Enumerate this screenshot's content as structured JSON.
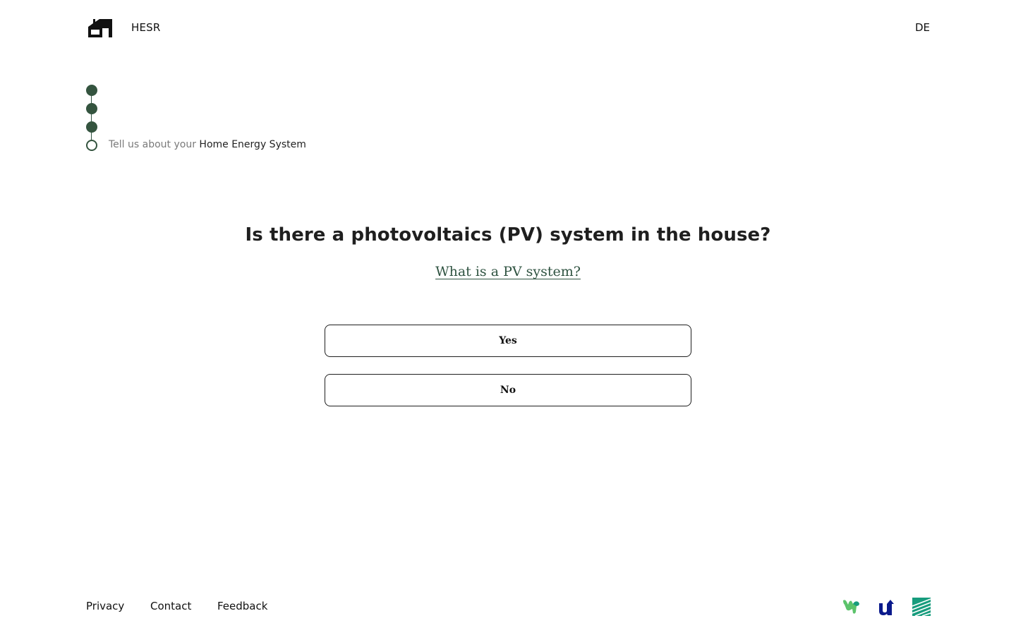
{
  "header": {
    "brand": "HESR",
    "language": "DE",
    "logo_icon": "house-icon"
  },
  "stepper": {
    "completed_steps": 3,
    "current_step_prefix": "Tell us about your",
    "current_step_title": "Home Energy System"
  },
  "main": {
    "question": "Is there a photovoltaics (PV) system in the house?",
    "help_link": "What is a PV system?",
    "options": [
      {
        "label": "Yes"
      },
      {
        "label": "No"
      }
    ]
  },
  "footer": {
    "links": [
      "Privacy",
      "Contact",
      "Feedback"
    ],
    "partner_logos": [
      "partner-logo-green-icon",
      "partner-logo-blue-icon",
      "partner-logo-teal-icon"
    ]
  },
  "colors": {
    "accent": "#34543f",
    "link": "#2f5341",
    "text": "#1f1f1f",
    "partner_green": "#5cc36b",
    "partner_blue": "#0a1a8c",
    "partner_teal": "#179c7d"
  }
}
